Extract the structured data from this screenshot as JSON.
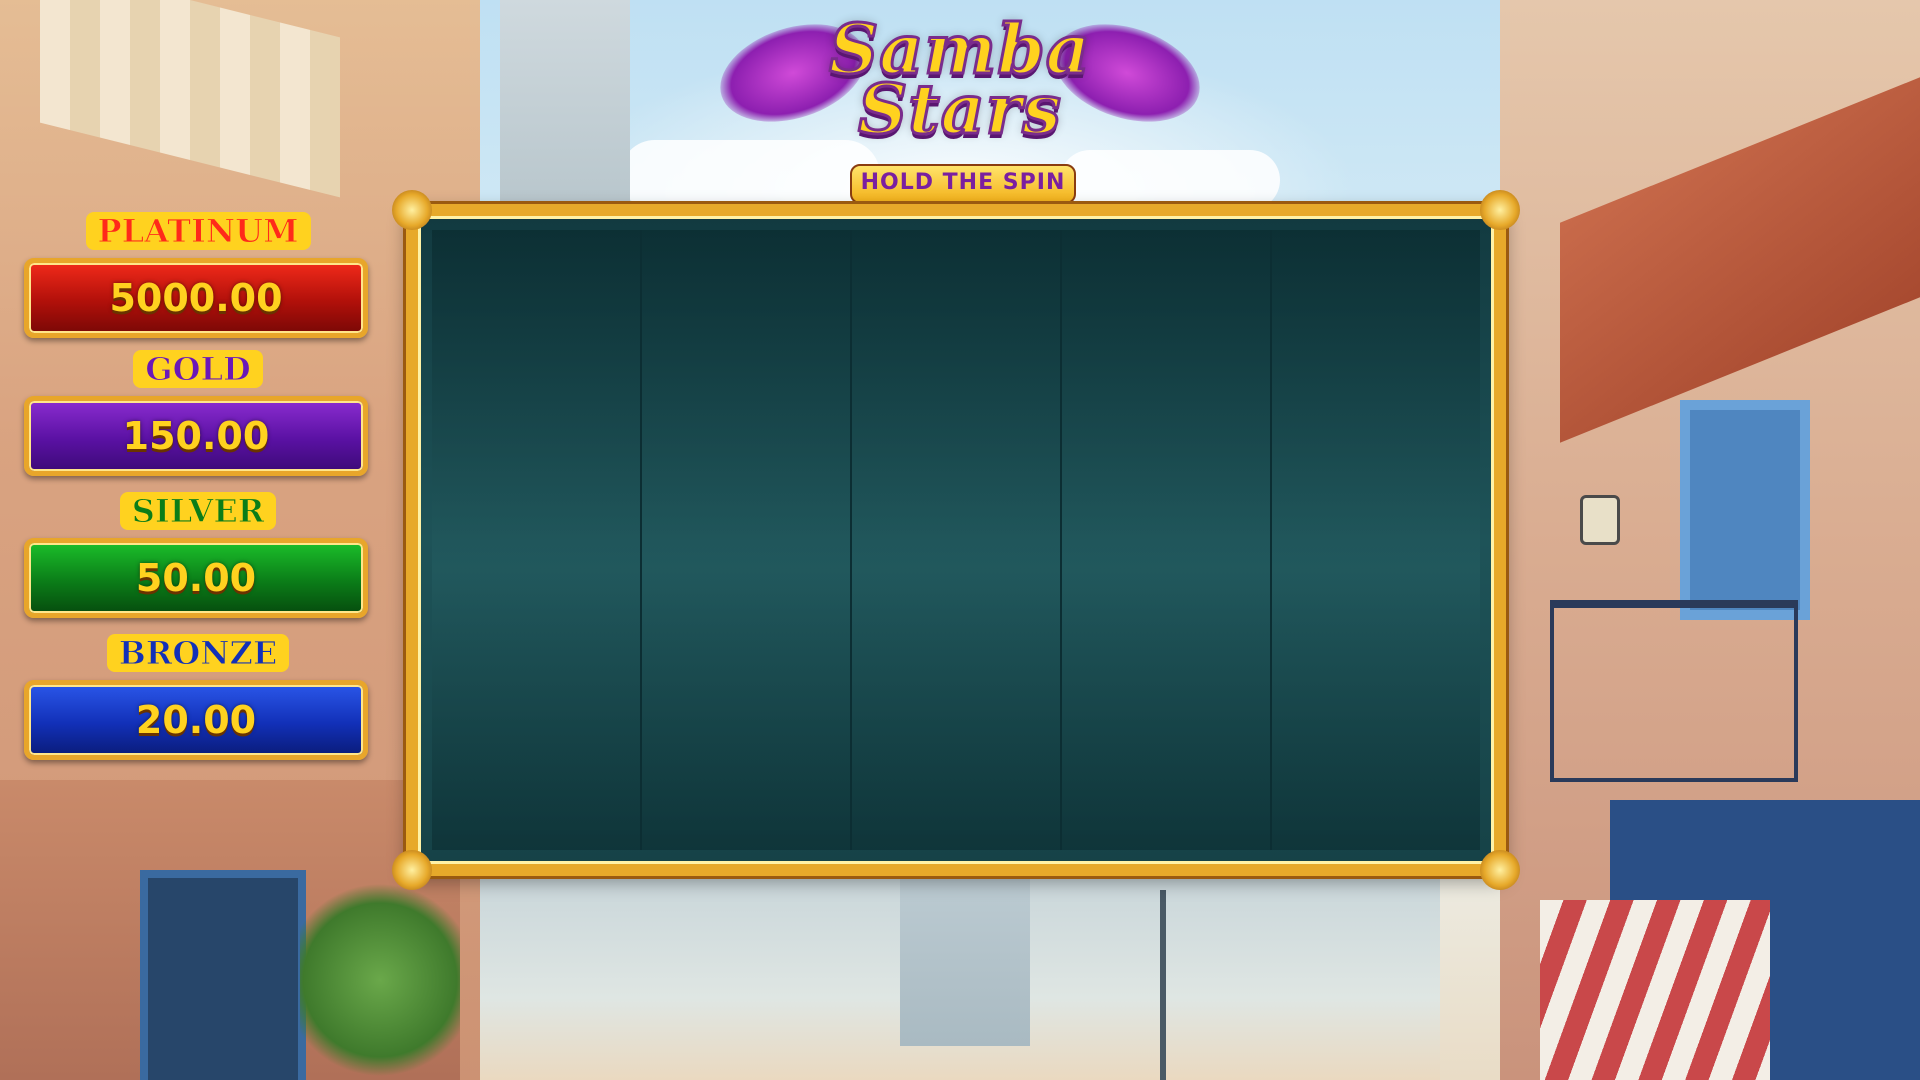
{
  "game": {
    "logo": {
      "line1": "Samba",
      "line2": "Stars",
      "subtitle": "HOLD THE SPIN"
    },
    "reels": {
      "count": 5
    },
    "jackpots": [
      {
        "name": "PLATINUM",
        "value": "5000.00",
        "color": "#b1100a"
      },
      {
        "name": "GOLD",
        "value": "150.00",
        "color": "#5a11a3"
      },
      {
        "name": "SILVER",
        "value": "50.00",
        "color": "#0b7d18"
      },
      {
        "name": "BRONZE",
        "value": "20.00",
        "color": "#1230b8"
      }
    ],
    "colors": {
      "frame_gold": "#e7a92a",
      "reel_background": "#1e5358",
      "label_yellow": "#ffd21f"
    }
  }
}
